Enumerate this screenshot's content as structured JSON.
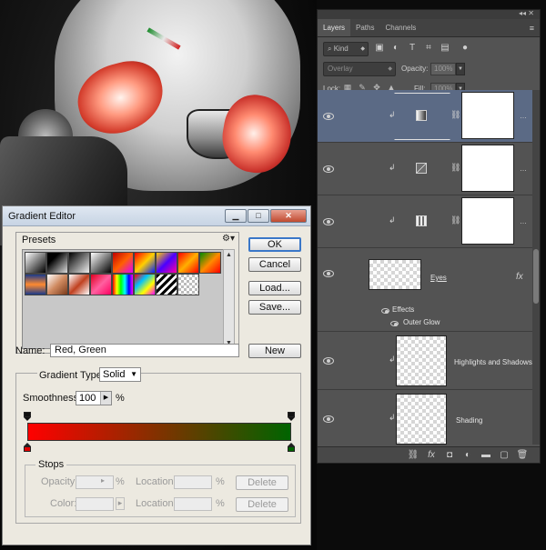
{
  "gradient_editor": {
    "title": "Gradient Editor",
    "presets_label": "Presets",
    "ok_label": "OK",
    "cancel_label": "Cancel",
    "load_label": "Load...",
    "save_label": "Save...",
    "name_label": "Name:",
    "name_value": "Red, Green",
    "new_label": "New",
    "gradient_type_label": "Gradient Type:",
    "gradient_type_value": "Solid",
    "smoothness_label": "Smoothness:",
    "smoothness_value": "100",
    "smoothness_unit": "%",
    "stops_label": "Stops",
    "opacity_label": "Opacity:",
    "color_label": "Color:",
    "location_label": "Location:",
    "percent": "%",
    "delete_label": "Delete",
    "gradient_colors": [
      "#ff0000",
      "#006400"
    ]
  },
  "layers_panel": {
    "tabs": [
      "Layers",
      "Paths",
      "Channels"
    ],
    "kind_label": "Kind",
    "blend_mode": "Overlay",
    "opacity_label": "Opacity:",
    "opacity_value": "100%",
    "lock_label": "Lock:",
    "fill_label": "Fill:",
    "fill_value": "100%",
    "layers": [
      {
        "name": "",
        "type": "adjustment-gradient",
        "selected": true
      },
      {
        "name": "",
        "type": "adjustment-curves",
        "selected": false
      },
      {
        "name": "",
        "type": "adjustment-levels",
        "selected": false
      },
      {
        "name": "Eyes",
        "type": "pixel",
        "fx": "fx",
        "effects_label": "Effects",
        "effect": "Outer Glow"
      },
      {
        "name": "Highlights and Shadows",
        "type": "pixel"
      },
      {
        "name": "Shading",
        "type": "pixel"
      }
    ]
  }
}
